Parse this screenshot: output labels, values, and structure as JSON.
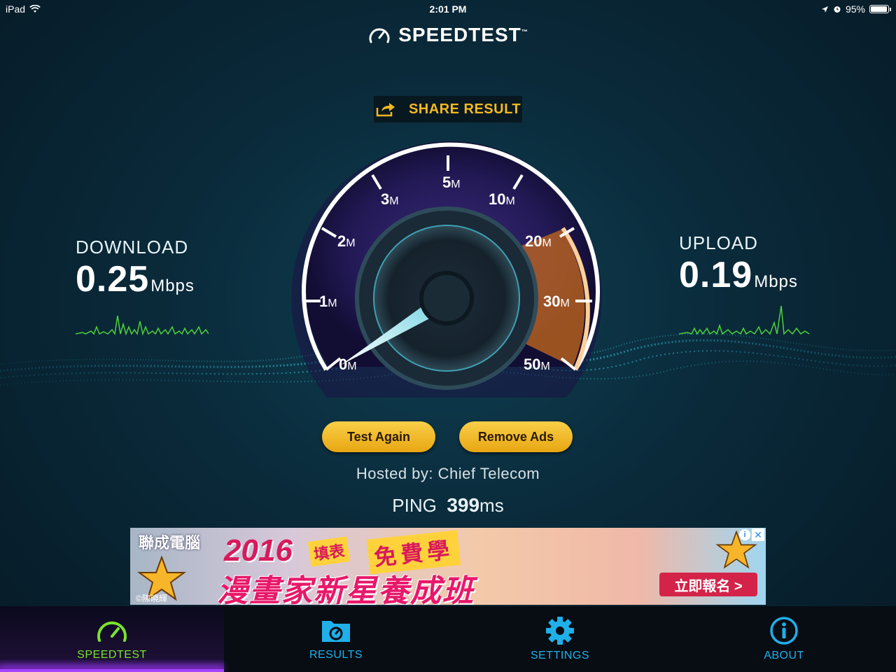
{
  "status_bar": {
    "device": "iPad",
    "time": "2:01 PM",
    "battery": "95%",
    "battery_level": 0.95
  },
  "header": {
    "title": "SPEEDTEST",
    "trademark": "™"
  },
  "share": {
    "label": "SHARE RESULT"
  },
  "download": {
    "label": "DOWNLOAD",
    "value": "0.25",
    "unit": "Mbps"
  },
  "upload": {
    "label": "UPLOAD",
    "value": "0.19",
    "unit": "Mbps"
  },
  "gauge": {
    "ticks": [
      {
        "num": "0",
        "unit": "M"
      },
      {
        "num": "1",
        "unit": "M"
      },
      {
        "num": "2",
        "unit": "M"
      },
      {
        "num": "3",
        "unit": "M"
      },
      {
        "num": "5",
        "unit": "M"
      },
      {
        "num": "10",
        "unit": "M"
      },
      {
        "num": "20",
        "unit": "M"
      },
      {
        "num": "30",
        "unit": "M"
      },
      {
        "num": "50",
        "unit": "M"
      }
    ]
  },
  "buttons": {
    "test_again": "Test Again",
    "remove_ads": "Remove Ads"
  },
  "hosted": "Hosted by: Chief Telecom",
  "ping": {
    "label": "PING",
    "value": "399",
    "unit": "ms"
  },
  "ad": {
    "brand": "聯成電腦",
    "year": "2016",
    "tag1": "填表",
    "tag2": "免費學",
    "headline": "漫畫家新星養成班",
    "cta": "立即報名 >",
    "credit": "©陳曉輝",
    "info": "i",
    "close": "✕"
  },
  "tabs": [
    {
      "label": "SPEEDTEST",
      "icon": "speedometer-icon",
      "color": "#7be52c"
    },
    {
      "label": "RESULTS",
      "icon": "results-folder-icon",
      "color": "#1fb0ea"
    },
    {
      "label": "SETTINGS",
      "icon": "gear-icon",
      "color": "#1fb0ea"
    },
    {
      "label": "ABOUT",
      "icon": "info-icon",
      "color": "#1fb0ea"
    }
  ]
}
